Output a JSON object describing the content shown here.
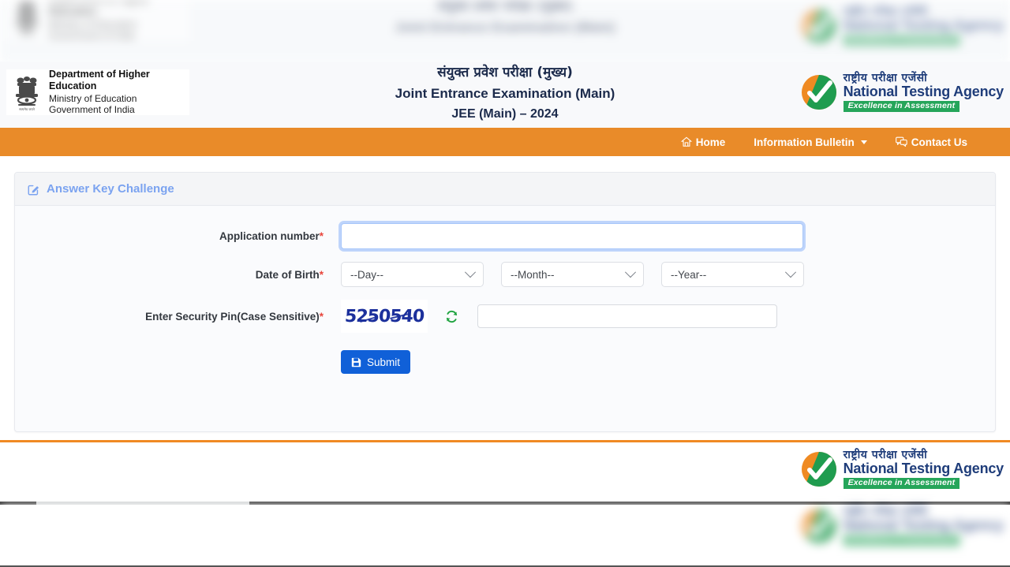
{
  "page": {
    "background_color": "#ffffff",
    "accent_orange": "#e98b29",
    "accent_blue": "#1060d8",
    "required_star_color": "#e8453c"
  },
  "header": {
    "emblem": {
      "icon": "ashoka-emblem-icon",
      "line1": "Department of Higher Education",
      "line2": "Ministry of Education",
      "line3": "Government of India"
    },
    "title_hindi": "संयुक्त प्रवेश परीक्षा (मुख्य)",
    "title_english": "Joint Entrance Examination (Main)",
    "title_sub": "JEE (Main) – 2024",
    "logo": {
      "icon": "nta-checkmark-logo-icon",
      "hindi": "राष्ट्रीय परीक्षा एजेंसी",
      "english": "National Testing Agency",
      "tagline": "Excellence in Assessment",
      "tagline_bg": "#25a55a"
    }
  },
  "navbar": {
    "background": "#e98b29",
    "items": [
      {
        "label": "Home",
        "icon": "home-icon",
        "has_caret": false
      },
      {
        "label": "Information Bulletin",
        "icon": "",
        "has_caret": true
      },
      {
        "label": "Contact Us",
        "icon": "chat-icon",
        "has_caret": false
      }
    ]
  },
  "card": {
    "header_icon": "edit-square-icon",
    "header_title": "Answer Key Challenge",
    "header_title_color": "#7ba3f0"
  },
  "form": {
    "application_number": {
      "label": "Application number",
      "required": true,
      "value": "",
      "placeholder": "",
      "focused": true
    },
    "date_of_birth": {
      "label": "Date of Birth",
      "required": true,
      "day": {
        "selected": "--Day--"
      },
      "month": {
        "selected": "--Month--"
      },
      "year": {
        "selected": "--Year--"
      }
    },
    "security_pin": {
      "label": "Enter Security Pin(Case Sensitive)",
      "required": true,
      "captcha_text": "5250540",
      "captcha_color": "#1c309c",
      "refresh_icon": "refresh-icon",
      "refresh_color": "#1ea33f",
      "input_value": "",
      "input_placeholder": ""
    },
    "submit": {
      "label": "Submit",
      "icon": "save-icon",
      "color": "#1060d8"
    }
  },
  "footer": {
    "divider_color": "#f08a23",
    "logo": {
      "icon": "nta-checkmark-logo-icon",
      "hindi": "राष्ट्रीय परीक्षा एजेंसी",
      "english": "National Testing Agency",
      "tagline": "Excellence in Assessment"
    }
  }
}
